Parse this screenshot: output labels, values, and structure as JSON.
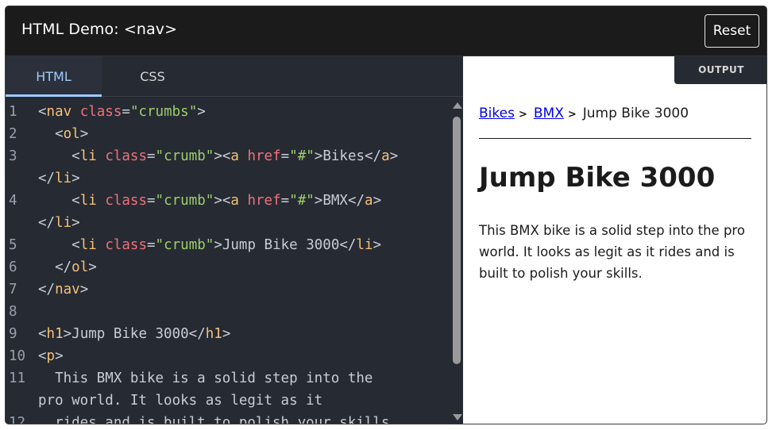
{
  "header": {
    "title": "HTML Demo: <nav>",
    "reset_label": "Reset"
  },
  "editor": {
    "tabs": [
      {
        "label": "HTML",
        "active": true
      },
      {
        "label": "CSS",
        "active": false
      }
    ],
    "lines": [
      {
        "num": "1",
        "tokens": [
          [
            "p",
            "<"
          ],
          [
            "t",
            "nav"
          ],
          [
            "p",
            " "
          ],
          [
            "a",
            "class"
          ],
          [
            "p",
            "="
          ],
          [
            "s",
            "\"crumbs\""
          ],
          [
            "p",
            ">"
          ]
        ]
      },
      {
        "num": "2",
        "tokens": [
          [
            "p",
            "  <"
          ],
          [
            "t",
            "ol"
          ],
          [
            "p",
            ">"
          ]
        ]
      },
      {
        "num": "3",
        "tokens": [
          [
            "p",
            "    <"
          ],
          [
            "t",
            "li"
          ],
          [
            "p",
            " "
          ],
          [
            "a",
            "class"
          ],
          [
            "p",
            "="
          ],
          [
            "s",
            "\"crumb\""
          ],
          [
            "p",
            "><"
          ],
          [
            "t",
            "a"
          ],
          [
            "p",
            " "
          ],
          [
            "a",
            "href"
          ],
          [
            "p",
            "="
          ],
          [
            "s",
            "\"#\""
          ],
          [
            "p",
            ">Bikes</"
          ],
          [
            "t",
            "a"
          ],
          [
            "p",
            ">"
          ]
        ]
      },
      {
        "num": "",
        "tokens": [
          [
            "p",
            "</"
          ],
          [
            "t",
            "li"
          ],
          [
            "p",
            ">"
          ]
        ]
      },
      {
        "num": "4",
        "tokens": [
          [
            "p",
            "    <"
          ],
          [
            "t",
            "li"
          ],
          [
            "p",
            " "
          ],
          [
            "a",
            "class"
          ],
          [
            "p",
            "="
          ],
          [
            "s",
            "\"crumb\""
          ],
          [
            "p",
            "><"
          ],
          [
            "t",
            "a"
          ],
          [
            "p",
            " "
          ],
          [
            "a",
            "href"
          ],
          [
            "p",
            "="
          ],
          [
            "s",
            "\"#\""
          ],
          [
            "p",
            ">BMX</"
          ],
          [
            "t",
            "a"
          ],
          [
            "p",
            ">"
          ]
        ]
      },
      {
        "num": "",
        "tokens": [
          [
            "p",
            "</"
          ],
          [
            "t",
            "li"
          ],
          [
            "p",
            ">"
          ]
        ]
      },
      {
        "num": "5",
        "tokens": [
          [
            "p",
            "    <"
          ],
          [
            "t",
            "li"
          ],
          [
            "p",
            " "
          ],
          [
            "a",
            "class"
          ],
          [
            "p",
            "="
          ],
          [
            "s",
            "\"crumb\""
          ],
          [
            "p",
            ">Jump Bike 3000</"
          ],
          [
            "t",
            "li"
          ],
          [
            "p",
            ">"
          ]
        ]
      },
      {
        "num": "6",
        "tokens": [
          [
            "p",
            "  </"
          ],
          [
            "t",
            "ol"
          ],
          [
            "p",
            ">"
          ]
        ]
      },
      {
        "num": "7",
        "tokens": [
          [
            "p",
            "</"
          ],
          [
            "t",
            "nav"
          ],
          [
            "p",
            ">"
          ]
        ]
      },
      {
        "num": "8",
        "tokens": []
      },
      {
        "num": "9",
        "tokens": [
          [
            "p",
            "<"
          ],
          [
            "t",
            "h1"
          ],
          [
            "p",
            ">Jump Bike 3000</"
          ],
          [
            "t",
            "h1"
          ],
          [
            "p",
            ">"
          ]
        ]
      },
      {
        "num": "10",
        "tokens": [
          [
            "p",
            "<"
          ],
          [
            "t",
            "p"
          ],
          [
            "p",
            ">"
          ]
        ]
      },
      {
        "num": "11",
        "tokens": [
          [
            "p",
            "  This BMX bike is a solid step into the"
          ]
        ]
      },
      {
        "num": "",
        "tokens": [
          [
            "p",
            "pro world. It looks as legit as it"
          ]
        ]
      },
      {
        "num": "12",
        "tokens": [
          [
            "p",
            "  rides and is built to polish your skills."
          ]
        ]
      }
    ]
  },
  "output": {
    "label": "OUTPUT",
    "crumbs": [
      {
        "text": "Bikes",
        "link": true
      },
      {
        "text": "BMX",
        "link": true
      },
      {
        "text": "Jump Bike 3000",
        "link": false
      }
    ],
    "separator": ">",
    "heading": "Jump Bike 3000",
    "paragraph": "This BMX bike is a solid step into the pro world. It looks as legit as it rides and is built to polish your skills."
  },
  "colors": {
    "accent_tab": "#9ecbff",
    "tag": "#f6c177",
    "attribute": "#f07178",
    "string": "#9ece6a",
    "link": "#0000ee"
  }
}
